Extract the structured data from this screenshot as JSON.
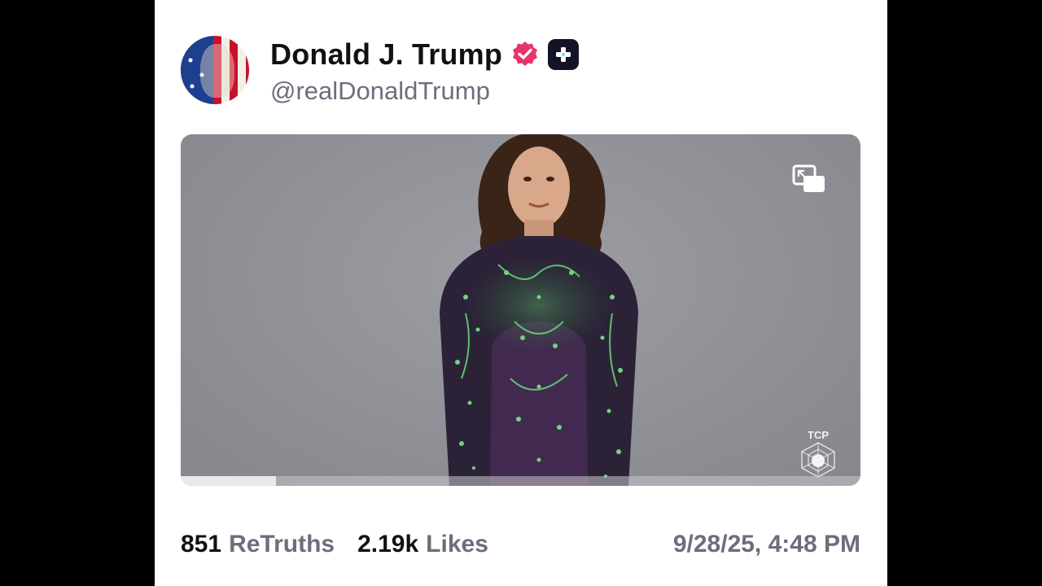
{
  "post": {
    "author_name": "Donald J. Trump",
    "handle": "@realDonaldTrump",
    "watermark": "TCP",
    "video_progress": 0.14,
    "stats": {
      "retruths_count": "851",
      "retruths_label": "ReTruths",
      "likes_count": "2.19k",
      "likes_label": "Likes"
    },
    "timestamp": "9/28/25, 4:48 PM"
  },
  "icons": {
    "verified": "verified-badge-icon",
    "plus": "truth-plus-icon",
    "pip": "picture-in-picture-icon"
  },
  "colors": {
    "verified": "#e8336b",
    "badge_bg": "#121426",
    "muted_text": "#6b6f7c"
  }
}
